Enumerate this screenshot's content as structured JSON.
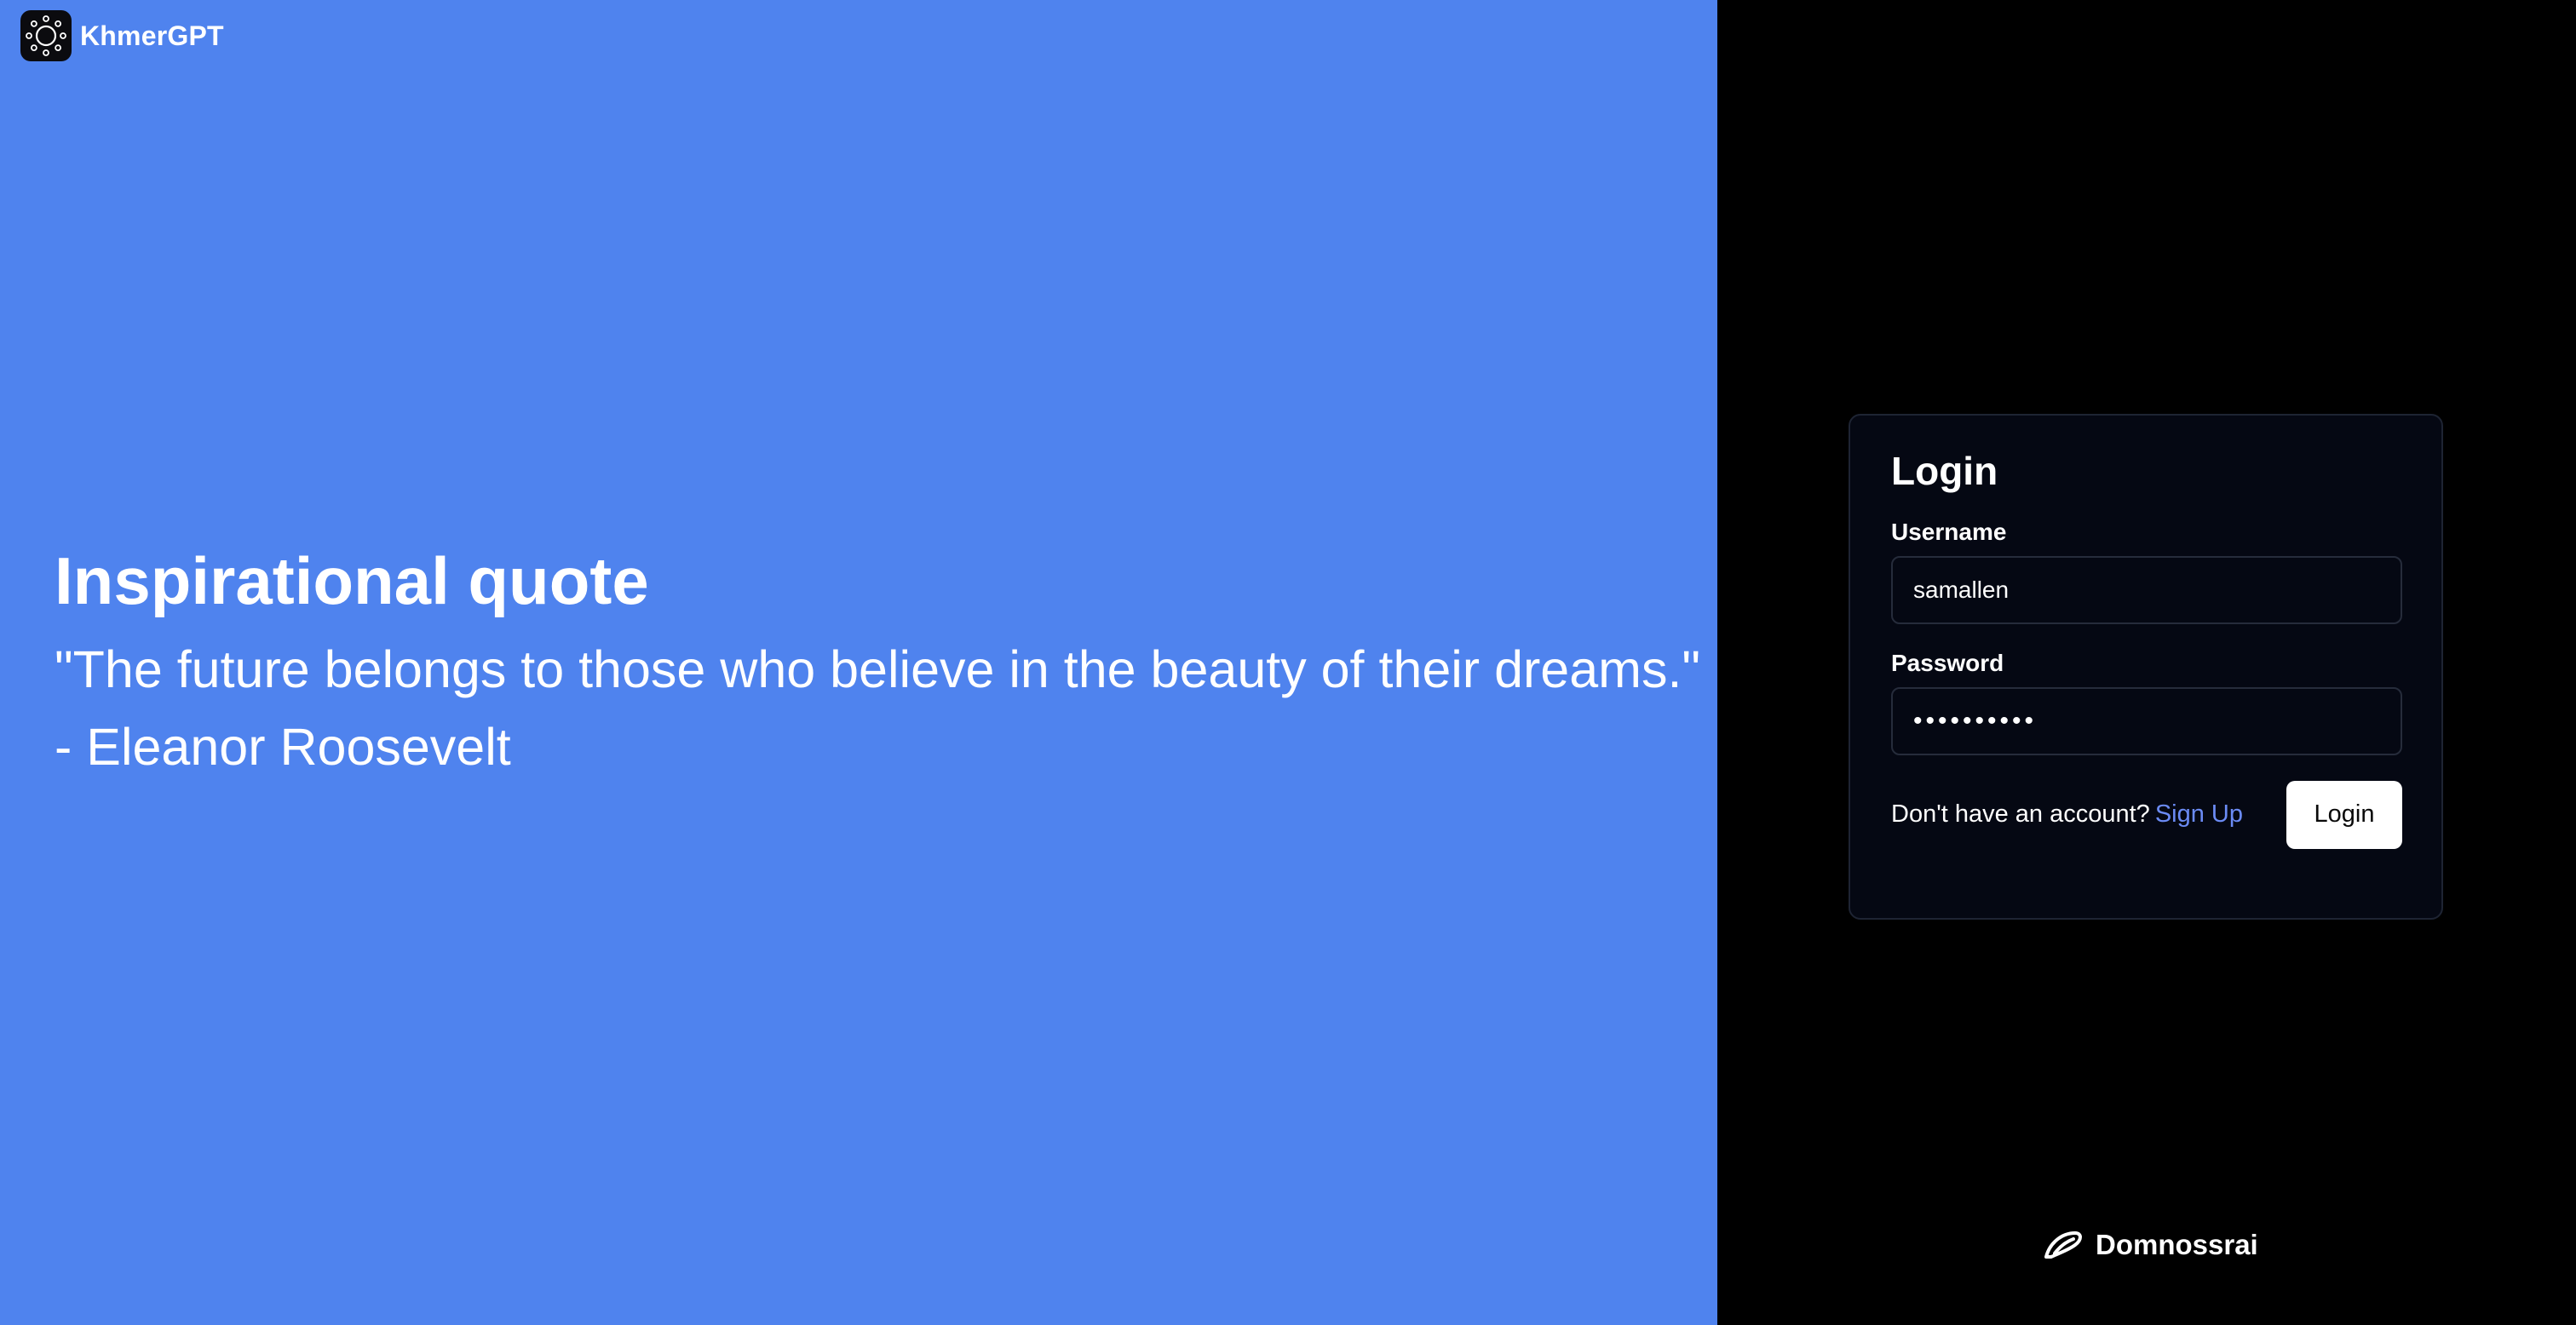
{
  "brand": {
    "name": "KhmerGPT",
    "logo_icon": "sun-ring-logo-icon"
  },
  "colors": {
    "left_panel_bg": "#4F83EE",
    "right_panel_bg": "#000000",
    "card_bg": "#050813",
    "link": "#6B8BF5"
  },
  "quote": {
    "heading": "Inspirational quote",
    "text": "\"The future belongs to those who believe in the beauty of their dreams.\"",
    "author": "- Eleanor Roosevelt"
  },
  "login_form": {
    "title": "Login",
    "username_label": "Username",
    "username_value": "samallen",
    "password_label": "Password",
    "password_masked": "••••••••••",
    "signup_prompt": "Don't have an account?",
    "signup_link": "Sign Up",
    "submit_label": "Login"
  },
  "footer": {
    "company_name": "Domnossrai",
    "logo_icon": "swoosh-logo-icon"
  }
}
